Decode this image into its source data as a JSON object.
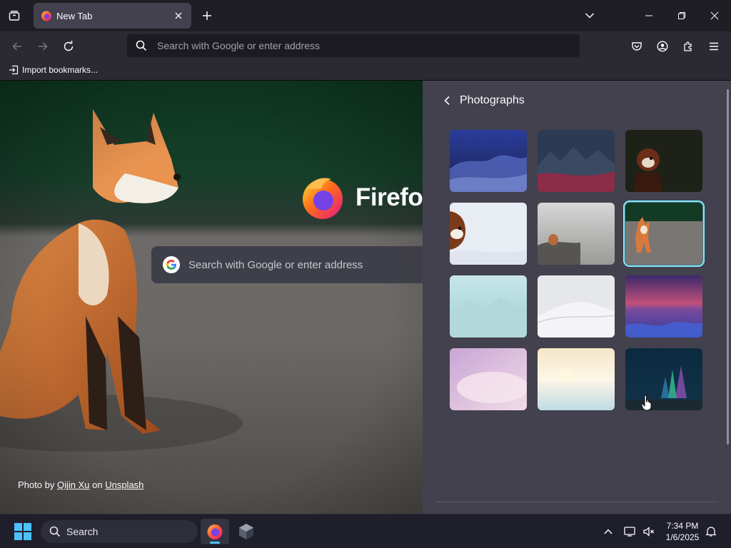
{
  "tab": {
    "title": "New Tab"
  },
  "urlbar": {
    "placeholder": "Search with Google or enter address"
  },
  "bookmarks": {
    "import_label": "Import bookmarks..."
  },
  "newtab": {
    "brand": "Firefox",
    "search_placeholder": "Search with Google or enter address",
    "credit_prefix": "Photo by",
    "credit_author": "Qijin Xu",
    "credit_mid": "on",
    "credit_site": "Unsplash"
  },
  "panel": {
    "title": "Photographs",
    "thumbnails": [
      {
        "name": "blue-clouds",
        "selected": false
      },
      {
        "name": "mountain-range",
        "selected": false
      },
      {
        "name": "red-panda-dark",
        "selected": false
      },
      {
        "name": "red-panda-snow",
        "selected": false
      },
      {
        "name": "fox-in-fog",
        "selected": false
      },
      {
        "name": "fox-sitting",
        "selected": true
      },
      {
        "name": "misty-mountains",
        "selected": false
      },
      {
        "name": "snowy-hills",
        "selected": false
      },
      {
        "name": "sunset-ocean",
        "selected": false
      },
      {
        "name": "pink-clouds",
        "selected": false
      },
      {
        "name": "beach-sunrise",
        "selected": false
      },
      {
        "name": "aurora",
        "selected": false
      }
    ]
  },
  "taskbar": {
    "search_label": "Search",
    "time": "7:34 PM",
    "date": "1/6/2025"
  },
  "colors": {
    "accent": "#80ebff",
    "panel_bg": "#42414d",
    "toolbar_bg": "#2b2a33"
  }
}
